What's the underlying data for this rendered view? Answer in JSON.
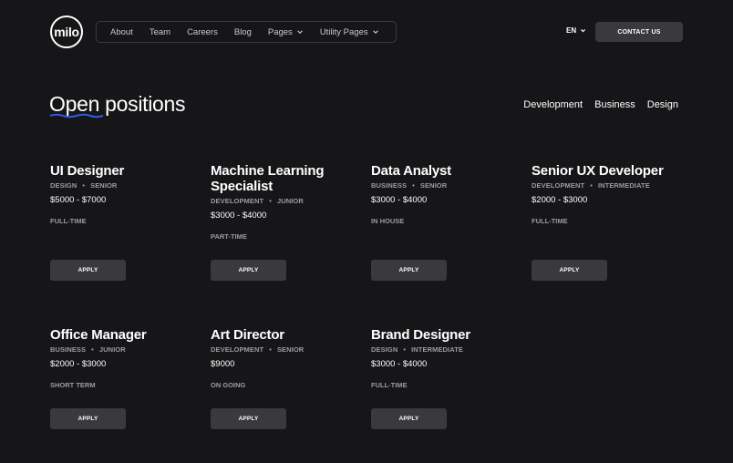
{
  "header": {
    "logo_text": "milo",
    "nav": [
      {
        "label": "About"
      },
      {
        "label": "Team"
      },
      {
        "label": "Careers"
      },
      {
        "label": "Blog"
      },
      {
        "label": "Pages",
        "dropdown": true
      },
      {
        "label": "Utility Pages",
        "dropdown": true
      }
    ],
    "language": "EN",
    "contact_label": "CONTACT US"
  },
  "section": {
    "title_highlight": "Open",
    "title_rest": " positions",
    "accent_color": "#2f5bea",
    "filters": [
      "Development",
      "Business",
      "Design"
    ]
  },
  "jobs": [
    {
      "title": "UI Designer",
      "dept": "DESIGN",
      "level": "SENIOR",
      "salary": "$5000 - $7000",
      "type": "FULL-TIME",
      "apply": "APPLY"
    },
    {
      "title": "Machine Learning Specialist",
      "dept": "DEVELOPMENT",
      "level": "JUNIOR",
      "salary": "$3000 - $4000",
      "type": "PART-TIME",
      "apply": "APPLY"
    },
    {
      "title": "Data Analyst",
      "dept": "BUSINESS",
      "level": "SENIOR",
      "salary": "$3000 - $4000",
      "type": "IN HOUSE",
      "apply": "APPLY"
    },
    {
      "title": "Senior UX Developer",
      "dept": "DEVELOPMENT",
      "level": "INTERMEDIATE",
      "salary": "$2000 - $3000",
      "type": "FULL-TIME",
      "apply": "APPLY"
    },
    {
      "title": "Office Manager",
      "dept": "BUSINESS",
      "level": "JUNIOR",
      "salary": "$2000 - $3000",
      "type": "SHORT TERM",
      "apply": "APPLY"
    },
    {
      "title": "Art Director",
      "dept": "DEVELOPMENT",
      "level": "SENIOR",
      "salary": "$9000",
      "type": "ON GOING",
      "apply": "APPLY"
    },
    {
      "title": "Brand Designer",
      "dept": "DESIGN",
      "level": "INTERMEDIATE",
      "salary": "$3000 - $4000",
      "type": "FULL-TIME",
      "apply": "APPLY"
    }
  ]
}
